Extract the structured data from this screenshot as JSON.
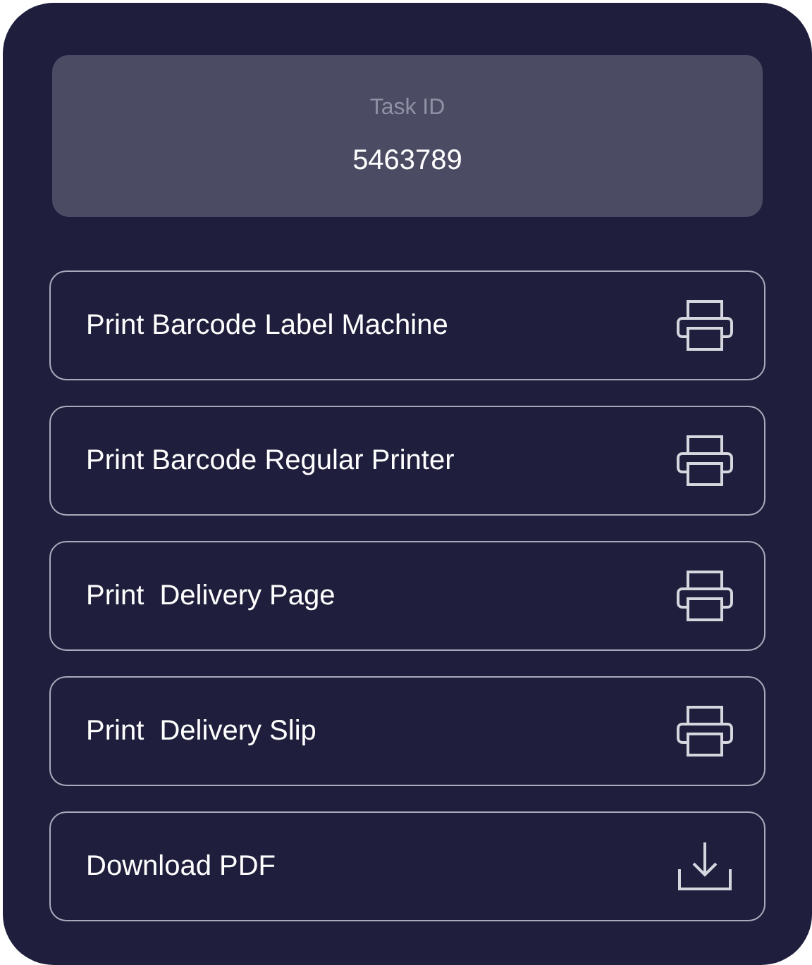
{
  "task": {
    "label": "Task ID",
    "value": "5463789"
  },
  "actions": [
    {
      "label": "Print Barcode Label Machine",
      "kind": "print"
    },
    {
      "label": "Print Barcode Regular Printer",
      "kind": "print"
    },
    {
      "label": "Print  Delivery Page",
      "kind": "print"
    },
    {
      "label": "Print  Delivery Slip",
      "kind": "print"
    },
    {
      "label": "Download PDF",
      "kind": "download"
    }
  ]
}
